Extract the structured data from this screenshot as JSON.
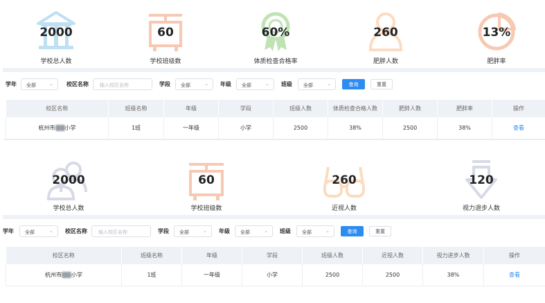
{
  "section1": {
    "stats": [
      {
        "value": "2000",
        "label": "学校总人数",
        "icon": "school-building-icon",
        "color": "#bfe0f2"
      },
      {
        "value": "60",
        "label": "学校班级数",
        "icon": "class-sign-icon",
        "color": "#f7c9b3"
      },
      {
        "value": "60%",
        "label": "体质检查合格率",
        "icon": "medal-ribbon-icon",
        "color": "#bfe3b4"
      },
      {
        "value": "260",
        "label": "肥胖人数",
        "icon": "person-icon",
        "color": "#fbdcc0"
      },
      {
        "value": "13%",
        "label": "肥胖率",
        "icon": "pie-ring-icon",
        "color": "#f7c9b3"
      }
    ],
    "filters": {
      "year_label": "学年",
      "year_value": "全部",
      "campus_label": "校区名称",
      "campus_placeholder": "输入校区名称",
      "stage_label": "学段",
      "stage_value": "全部",
      "grade_label": "年级",
      "grade_value": "全部",
      "class_label": "班级",
      "class_value": "全部",
      "search_label": "查询",
      "reset_label": "重置"
    },
    "table": {
      "headers": [
        "校区名称",
        "班级名称",
        "年级",
        "学段",
        "班级人数",
        "体质检查合格人数",
        "肥胖人数",
        "肥胖率",
        "操作"
      ],
      "rows": [
        {
          "campus_pre": "杭州市",
          "campus_post": "小学",
          "class": "1班",
          "grade": "一年级",
          "stage": "小学",
          "count": "2500",
          "pass": "38%",
          "obese": "2500",
          "rate": "38%",
          "action": "查看"
        }
      ]
    }
  },
  "section2": {
    "stats": [
      {
        "value": "2000",
        "label": "学校总人数",
        "icon": "people-group-icon",
        "color": "#d7dae6"
      },
      {
        "value": "60",
        "label": "学校班级数",
        "icon": "class-sign-icon",
        "color": "#f7c9b3"
      },
      {
        "value": "260",
        "label": "近视人数",
        "icon": "glasses-icon",
        "color": "#fbdcc0"
      },
      {
        "value": "120",
        "label": "视力退步人数",
        "icon": "down-arrow-icon",
        "color": "#d7dae6"
      }
    ],
    "filters": {
      "year_label": "学年",
      "year_value": "全部",
      "campus_label": "校区名称",
      "campus_placeholder": "输入校区名称",
      "stage_label": "学段",
      "stage_value": "全部",
      "grade_label": "年级",
      "grade_value": "全部",
      "class_label": "班级",
      "class_value": "全部",
      "search_label": "查询",
      "reset_label": "重置"
    },
    "table": {
      "headers": [
        "校区名称",
        "班级名称",
        "年级",
        "学段",
        "班级人数",
        "近视人数",
        "视力进步人数",
        "操作"
      ],
      "rows": [
        {
          "campus_pre": "杭州市",
          "campus_post": "小学",
          "class": "1班",
          "grade": "一年级",
          "stage": "小学",
          "count": "2500",
          "myopia": "2500",
          "improve": "38%",
          "action": "查看"
        }
      ]
    }
  }
}
